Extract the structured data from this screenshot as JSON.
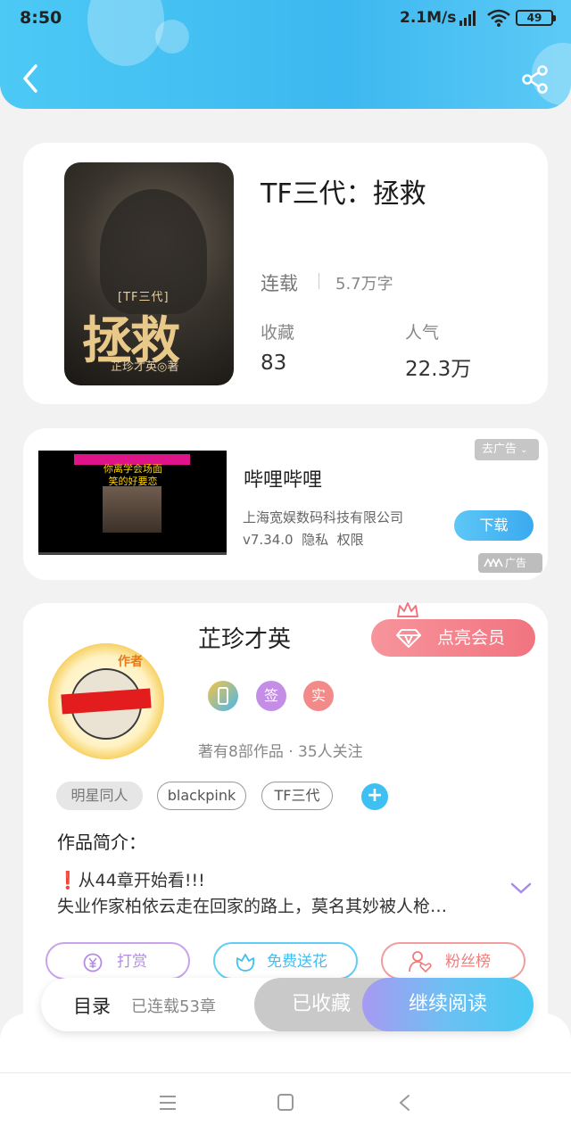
{
  "status_bar": {
    "time": "8:50",
    "network_speed": "2.1M/s",
    "battery": "49"
  },
  "header": {
    "back_icon": "chevron-left-icon",
    "share_icon": "share-icon"
  },
  "book": {
    "cover_series": "[TF三代]",
    "cover_title": "拯救",
    "cover_author": "芷珍才英◎著",
    "title": "TF三代：拯救",
    "status": "连载",
    "word_count": "5.7万字",
    "favorites_label": "收藏",
    "favorites_value": "83",
    "popularity_label": "人气",
    "popularity_value": "22.3万"
  },
  "ad": {
    "video_headline": "你离学会场面\n笑的好要恋",
    "app_name": "哔哩哔哩",
    "company": "上海宽娱数码科技有限公司",
    "version_info": "v7.34.0  隐私  权限",
    "remove_label": "去广告",
    "download_label": "下载",
    "ad_badge": "广告"
  },
  "author": {
    "avatar_tag": "作者",
    "name": "芷珍才英",
    "vip_label": "点亮会员",
    "badges": [
      "签",
      "实"
    ],
    "stats": "著有8部作品 · 35人关注",
    "tags": [
      "明星同人",
      "blackpink",
      "TF三代"
    ],
    "add_tag": "+",
    "intro_label": "作品简介：",
    "intro_line1": "❗从44章开始看!!!",
    "intro_line2": "失业作家柏依云走在回家的路上，莫名其妙被人枪…",
    "actions": {
      "reward": "打赏",
      "flower": "免费送花",
      "fans": "粉丝榜"
    }
  },
  "bottom": {
    "toc_label": "目录",
    "toc_count": "已连载53章",
    "saved_label": "已收藏",
    "read_label": "继续阅读"
  },
  "colors": {
    "accent": "#3db8f0",
    "vip": "#f17480",
    "reward": "#b48ce6",
    "flower": "#3fc0f3",
    "fans": "#ef7d7d"
  }
}
